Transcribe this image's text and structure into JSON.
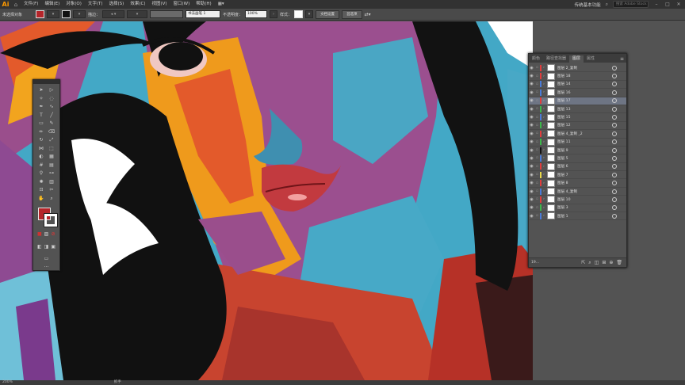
{
  "menubar": {
    "logo": "Ai",
    "items": [
      "文件(F)",
      "编辑(E)",
      "对象(O)",
      "文字(T)",
      "选择(S)",
      "效果(C)",
      "视图(V)",
      "窗口(W)",
      "帮助(H)"
    ],
    "workspace": "传统基本功能",
    "search_placeholder": "搜索 Adobe Stock"
  },
  "controlbar": {
    "selection_label": "未选择对象",
    "stroke_label": "描边：",
    "brush_value": "书法画笔 1",
    "opacity_label": "不透明度：",
    "opacity_value": "100%",
    "style_label": "样式：",
    "doc_setup_button": "文档设置",
    "preferences_button": "首选项",
    "colors": {
      "fill": "#b5252a"
    }
  },
  "panel": {
    "tabs": [
      "颜色",
      "路径查找器",
      "图层",
      "属性"
    ],
    "active_tab": "图层",
    "layers": [
      {
        "name": "图层 2_复制",
        "color": "#e23c3c",
        "selected": false
      },
      {
        "name": "图层 18",
        "color": "#e23c3c",
        "selected": false
      },
      {
        "name": "图层 14",
        "color": "#4a7bd8",
        "selected": false
      },
      {
        "name": "图层 16",
        "color": "#4a7bd8",
        "selected": false
      },
      {
        "name": "图层 17",
        "color": "#e23c3c",
        "selected": true
      },
      {
        "name": "图层 13",
        "color": "#3cb84a",
        "selected": false
      },
      {
        "name": "图层 15",
        "color": "#4a7bd8",
        "selected": false
      },
      {
        "name": "图层 12",
        "color": "#3cb84a",
        "selected": false
      },
      {
        "name": "图层 4_复制 _2",
        "color": "#e23c3c",
        "selected": false
      },
      {
        "name": "图层 11",
        "color": "#3cb84a",
        "selected": false
      },
      {
        "name": "图层 9",
        "color": "#111111",
        "selected": false
      },
      {
        "name": "图层 5",
        "color": "#4a7bd8",
        "selected": false
      },
      {
        "name": "图层 6",
        "color": "#e23c3c",
        "selected": false
      },
      {
        "name": "图层 7",
        "color": "#e8d84a",
        "selected": false
      },
      {
        "name": "图层 8",
        "color": "#e23c3c",
        "selected": false
      },
      {
        "name": "图层 4_复制",
        "color": "#4a7bd8",
        "selected": false
      },
      {
        "name": "图层 10",
        "color": "#e23c3c",
        "selected": false
      },
      {
        "name": "图层 3",
        "color": "#3cb84a",
        "selected": false
      },
      {
        "name": "图层 1",
        "color": "#4a7bd8",
        "selected": false
      }
    ],
    "count_label": "19..."
  },
  "statusbar": {
    "zoom": "200%",
    "tool": "抓手"
  }
}
